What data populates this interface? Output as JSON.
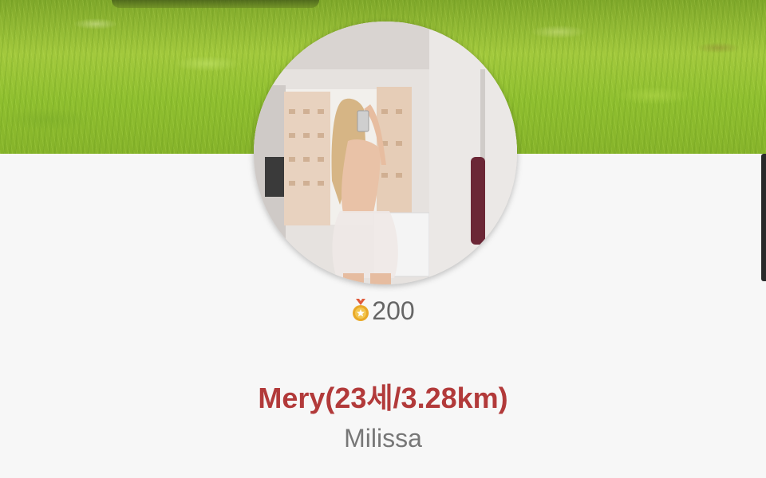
{
  "cover": {
    "icon": "grass-cover-image"
  },
  "avatar": {
    "icon": "profile-photo"
  },
  "points": {
    "icon": "medal-icon",
    "value": "200",
    "medal_color": "#e9a928"
  },
  "profile": {
    "name_line": "Mery(23세/3.28km)",
    "nickname": "Milissa",
    "name_color": "#b23a3a"
  }
}
